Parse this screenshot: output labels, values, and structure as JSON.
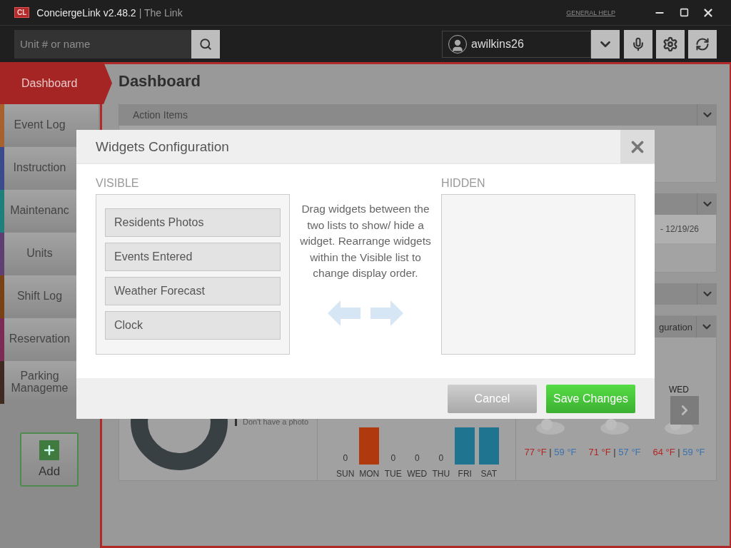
{
  "window": {
    "logo": "CL",
    "app_name": "ConciergeLink v2.48.2",
    "subtitle": "| The Link",
    "help_link": "GENERAL HELP"
  },
  "search": {
    "placeholder": "Unit # or name"
  },
  "user": {
    "name": "awilkins26"
  },
  "nav": [
    {
      "label": "Dashboard",
      "selected": true
    },
    {
      "label": "Event Log",
      "selected": false,
      "color": "#a8602c"
    },
    {
      "label": "Instruction",
      "selected": false,
      "color": "#3b4a8a"
    },
    {
      "label": "Maintenanc",
      "selected": false,
      "color": "#1f7f7a"
    },
    {
      "label": "Units",
      "selected": false,
      "color": "#5f3f72"
    },
    {
      "label": "Shift Log",
      "selected": false,
      "color": "#7a4214"
    },
    {
      "label": "Reservation",
      "selected": false,
      "color": "#7c2a56"
    },
    {
      "label": "Parking Manageme",
      "selected": false,
      "color": "#3e2a20"
    }
  ],
  "add_button": "Add",
  "page_title": "Dashboard",
  "panels": [
    {
      "kind": "titled",
      "title": "Action Items"
    },
    {
      "kind": "dated",
      "date": "- 12/19/26"
    },
    {
      "kind": "collapsed"
    }
  ],
  "photos_widget": {
    "legend": "Don't have a photo"
  },
  "events_widget": {
    "days": [
      {
        "label": "SUN",
        "count": "0"
      },
      {
        "label": "MON",
        "color": "#b03a0e"
      },
      {
        "label": "TUE",
        "count": "0"
      },
      {
        "label": "WED",
        "count": "0"
      },
      {
        "label": "THU",
        "count": "0"
      },
      {
        "label": "FRI",
        "color": "#1f7590"
      },
      {
        "label": "SAT",
        "color": "#1f7590"
      }
    ]
  },
  "weather_widget": {
    "header": "guration",
    "forecast": [
      {
        "high": "77 °F",
        "separator": "|",
        "low": "59 °F"
      },
      {
        "high": "71 °F",
        "separator": "|",
        "low": "57 °F"
      },
      {
        "day": "WED",
        "high": "64 °F",
        "separator": "|",
        "low": "59 °F"
      }
    ]
  },
  "dialog": {
    "title": "Widgets Configuration",
    "visible_label": "VISIBLE",
    "visible_items": [
      "Residents Photos",
      "Events Entered",
      "Weather Forecast",
      "Clock"
    ],
    "hint": "Drag widgets between the two lists to show/ hide a widget. Rearrange widgets within the Visible list to change display order.",
    "hidden_label": "HIDDEN",
    "buttons": [
      {
        "label": "Cancel",
        "kind": "secondary"
      },
      {
        "label": "Save Changes",
        "kind": "primary"
      }
    ]
  }
}
